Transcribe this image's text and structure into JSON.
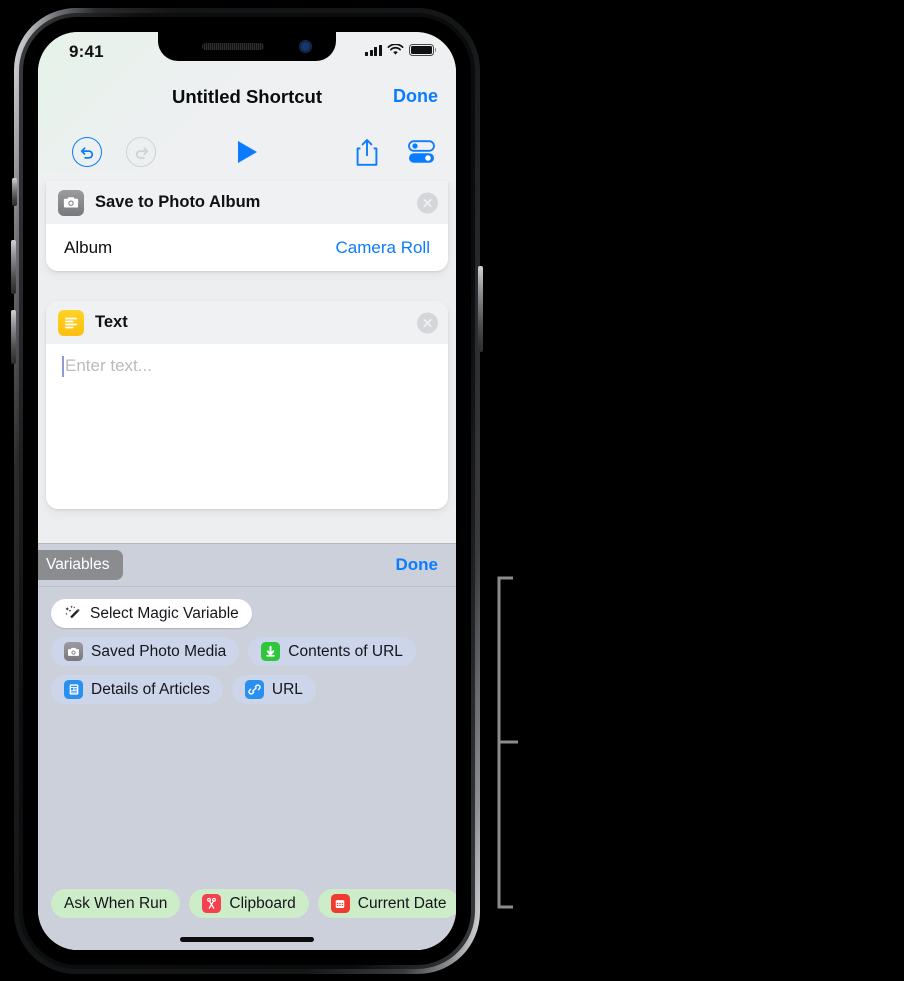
{
  "status_bar": {
    "time": "9:41",
    "signal_icon": "cellular-bars-icon",
    "wifi_icon": "wifi-icon",
    "battery_icon": "battery-icon"
  },
  "nav": {
    "title": "Untitled Shortcut",
    "done_label": "Done"
  },
  "toolbar": {
    "undo": "undo-icon",
    "redo": "redo-icon",
    "run": "play-icon",
    "share": "share-icon",
    "settings": "settings-toggles-icon"
  },
  "actions": [
    {
      "title": "Save to Photo Album",
      "icon": "camera-icon",
      "close_label": "✕",
      "param_label": "Album",
      "param_value": "Camera Roll"
    },
    {
      "title": "Text",
      "icon": "text-lines-icon",
      "close_label": "✕",
      "placeholder": "Enter text...",
      "value": ""
    }
  ],
  "variables_panel": {
    "tab_label": "Variables",
    "done_label": "Done",
    "magic_chip": {
      "label": "Select Magic Variable",
      "icon": "magic-wand-icon"
    },
    "variable_chips": [
      {
        "label": "Saved Photo Media",
        "icon": "camera-icon",
        "style": "blue"
      },
      {
        "label": "Contents of URL",
        "icon": "download-arrow-icon",
        "style": "blue"
      },
      {
        "label": "Details of Articles",
        "icon": "article-icon",
        "style": "blue"
      },
      {
        "label": "URL",
        "icon": "link-icon",
        "style": "blue"
      }
    ],
    "bottom_chips": [
      {
        "label": "Ask When Run",
        "icon": "",
        "style": "green"
      },
      {
        "label": "Clipboard",
        "icon": "scissors-icon",
        "style": "green"
      },
      {
        "label": "Current Date",
        "icon": "calendar-icon",
        "style": "green"
      }
    ]
  },
  "colors": {
    "accent_blue": "#0b7cff",
    "chip_blue": "#ccd5e9",
    "chip_green": "#cdecc8",
    "panel_bg": "#ccd0da",
    "list_bg": "#eceef0",
    "yellow_icon": "#ffd426",
    "green_icon": "#2ec63a",
    "red_icon": "#f5414f"
  }
}
